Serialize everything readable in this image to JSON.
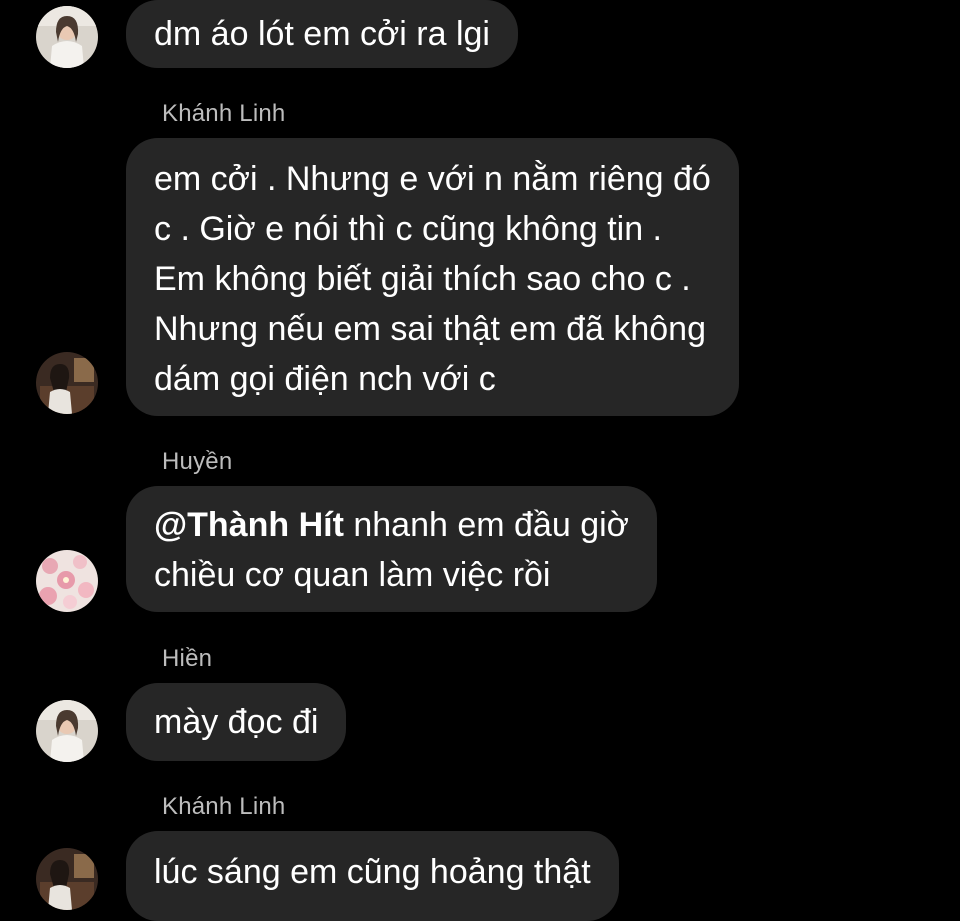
{
  "messages": [
    {
      "sender": "",
      "lines": [
        "dm áo lót em cởi ra lgi"
      ],
      "avatar": "avatar-white-shirt-girl"
    },
    {
      "sender": "Khánh Linh",
      "lines": [
        "em cởi . Nhưng e với n nằm riêng đó",
        "c . Giờ e nói thì c cũng không tin .",
        "Em không biết giải thích sao cho c .",
        "Nhưng nếu em sai thật em đã không",
        "dám gọi điện nch với c"
      ],
      "avatar": "avatar-girl-dark-room"
    },
    {
      "sender": "Huyền",
      "mention": "@Thành Hít",
      "lines": [
        " nhanh em đầu giờ",
        "chiều cơ quan làm việc rồi"
      ],
      "avatar": "avatar-pink-flowers"
    },
    {
      "sender": "Hiền",
      "lines": [
        "mày đọc đi"
      ],
      "avatar": "avatar-white-shirt-girl"
    },
    {
      "sender": "Khánh Linh",
      "lines": [
        "lúc sáng em cũng hoảng thật"
      ],
      "avatar": "avatar-girl-dark-room"
    }
  ],
  "colors": {
    "background": "#000000",
    "bubble": "#262626",
    "sender_name": "#bdbdbd",
    "text": "#ffffff"
  }
}
